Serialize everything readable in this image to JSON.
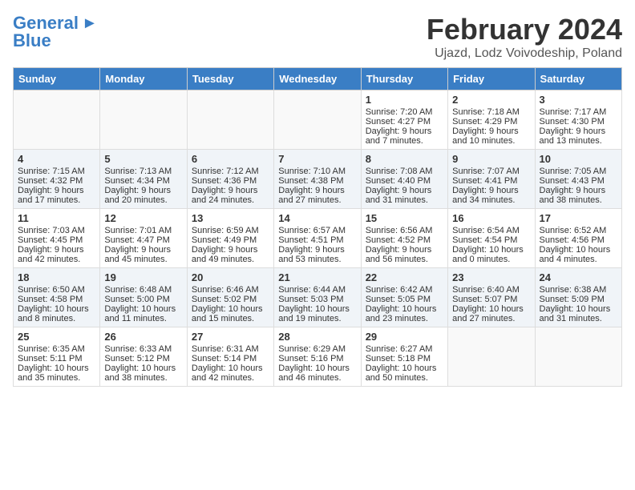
{
  "header": {
    "logo_general": "General",
    "logo_blue": "Blue",
    "month_title": "February 2024",
    "location": "Ujazd, Lodz Voivodeship, Poland"
  },
  "days_of_week": [
    "Sunday",
    "Monday",
    "Tuesday",
    "Wednesday",
    "Thursday",
    "Friday",
    "Saturday"
  ],
  "weeks": [
    [
      {
        "day": "",
        "info": ""
      },
      {
        "day": "",
        "info": ""
      },
      {
        "day": "",
        "info": ""
      },
      {
        "day": "",
        "info": ""
      },
      {
        "day": "1",
        "info": "Sunrise: 7:20 AM\nSunset: 4:27 PM\nDaylight: 9 hours\nand 7 minutes."
      },
      {
        "day": "2",
        "info": "Sunrise: 7:18 AM\nSunset: 4:29 PM\nDaylight: 9 hours\nand 10 minutes."
      },
      {
        "day": "3",
        "info": "Sunrise: 7:17 AM\nSunset: 4:30 PM\nDaylight: 9 hours\nand 13 minutes."
      }
    ],
    [
      {
        "day": "4",
        "info": "Sunrise: 7:15 AM\nSunset: 4:32 PM\nDaylight: 9 hours\nand 17 minutes."
      },
      {
        "day": "5",
        "info": "Sunrise: 7:13 AM\nSunset: 4:34 PM\nDaylight: 9 hours\nand 20 minutes."
      },
      {
        "day": "6",
        "info": "Sunrise: 7:12 AM\nSunset: 4:36 PM\nDaylight: 9 hours\nand 24 minutes."
      },
      {
        "day": "7",
        "info": "Sunrise: 7:10 AM\nSunset: 4:38 PM\nDaylight: 9 hours\nand 27 minutes."
      },
      {
        "day": "8",
        "info": "Sunrise: 7:08 AM\nSunset: 4:40 PM\nDaylight: 9 hours\nand 31 minutes."
      },
      {
        "day": "9",
        "info": "Sunrise: 7:07 AM\nSunset: 4:41 PM\nDaylight: 9 hours\nand 34 minutes."
      },
      {
        "day": "10",
        "info": "Sunrise: 7:05 AM\nSunset: 4:43 PM\nDaylight: 9 hours\nand 38 minutes."
      }
    ],
    [
      {
        "day": "11",
        "info": "Sunrise: 7:03 AM\nSunset: 4:45 PM\nDaylight: 9 hours\nand 42 minutes."
      },
      {
        "day": "12",
        "info": "Sunrise: 7:01 AM\nSunset: 4:47 PM\nDaylight: 9 hours\nand 45 minutes."
      },
      {
        "day": "13",
        "info": "Sunrise: 6:59 AM\nSunset: 4:49 PM\nDaylight: 9 hours\nand 49 minutes."
      },
      {
        "day": "14",
        "info": "Sunrise: 6:57 AM\nSunset: 4:51 PM\nDaylight: 9 hours\nand 53 minutes."
      },
      {
        "day": "15",
        "info": "Sunrise: 6:56 AM\nSunset: 4:52 PM\nDaylight: 9 hours\nand 56 minutes."
      },
      {
        "day": "16",
        "info": "Sunrise: 6:54 AM\nSunset: 4:54 PM\nDaylight: 10 hours\nand 0 minutes."
      },
      {
        "day": "17",
        "info": "Sunrise: 6:52 AM\nSunset: 4:56 PM\nDaylight: 10 hours\nand 4 minutes."
      }
    ],
    [
      {
        "day": "18",
        "info": "Sunrise: 6:50 AM\nSunset: 4:58 PM\nDaylight: 10 hours\nand 8 minutes."
      },
      {
        "day": "19",
        "info": "Sunrise: 6:48 AM\nSunset: 5:00 PM\nDaylight: 10 hours\nand 11 minutes."
      },
      {
        "day": "20",
        "info": "Sunrise: 6:46 AM\nSunset: 5:02 PM\nDaylight: 10 hours\nand 15 minutes."
      },
      {
        "day": "21",
        "info": "Sunrise: 6:44 AM\nSunset: 5:03 PM\nDaylight: 10 hours\nand 19 minutes."
      },
      {
        "day": "22",
        "info": "Sunrise: 6:42 AM\nSunset: 5:05 PM\nDaylight: 10 hours\nand 23 minutes."
      },
      {
        "day": "23",
        "info": "Sunrise: 6:40 AM\nSunset: 5:07 PM\nDaylight: 10 hours\nand 27 minutes."
      },
      {
        "day": "24",
        "info": "Sunrise: 6:38 AM\nSunset: 5:09 PM\nDaylight: 10 hours\nand 31 minutes."
      }
    ],
    [
      {
        "day": "25",
        "info": "Sunrise: 6:35 AM\nSunset: 5:11 PM\nDaylight: 10 hours\nand 35 minutes."
      },
      {
        "day": "26",
        "info": "Sunrise: 6:33 AM\nSunset: 5:12 PM\nDaylight: 10 hours\nand 38 minutes."
      },
      {
        "day": "27",
        "info": "Sunrise: 6:31 AM\nSunset: 5:14 PM\nDaylight: 10 hours\nand 42 minutes."
      },
      {
        "day": "28",
        "info": "Sunrise: 6:29 AM\nSunset: 5:16 PM\nDaylight: 10 hours\nand 46 minutes."
      },
      {
        "day": "29",
        "info": "Sunrise: 6:27 AM\nSunset: 5:18 PM\nDaylight: 10 hours\nand 50 minutes."
      },
      {
        "day": "",
        "info": ""
      },
      {
        "day": "",
        "info": ""
      }
    ]
  ]
}
